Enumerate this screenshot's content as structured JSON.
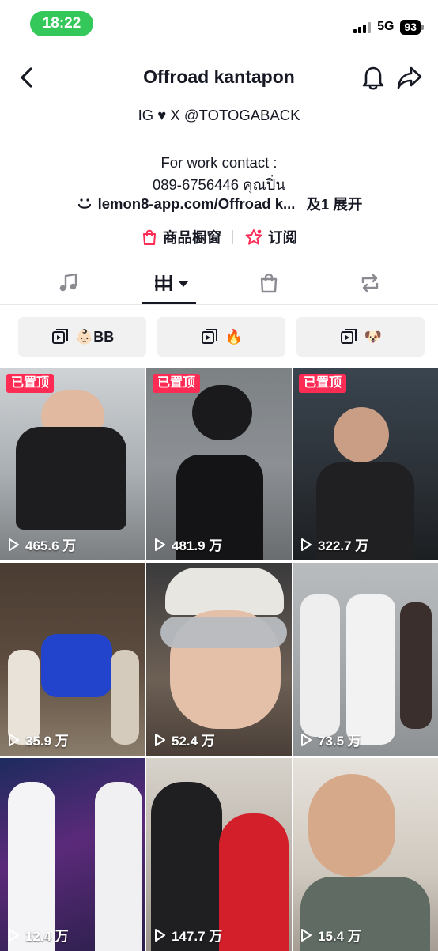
{
  "status": {
    "time": "18:22",
    "network": "5G",
    "battery": "93"
  },
  "nav": {
    "title": "Offroad kantapon"
  },
  "bio": {
    "line1": "IG ♥ X @TOTOGABACK",
    "line2": "For work contact :",
    "line3": "089-6756446 คุณปิ่น",
    "link": "lemon8-app.com/Offroad k...",
    "expand": "及1 展开"
  },
  "pills": {
    "shop": "商品橱窗",
    "subscribe": "订阅"
  },
  "tabs": [
    "music-icon",
    "grid-icon",
    "bag-icon",
    "repost-icon"
  ],
  "collections": [
    {
      "label": "👶🏻BB"
    },
    {
      "label": "🔥"
    },
    {
      "label": "🐶"
    }
  ],
  "videos": [
    {
      "pinned": "已置顶",
      "views": "465.6 万"
    },
    {
      "pinned": "已置顶",
      "views": "481.9 万"
    },
    {
      "pinned": "已置顶",
      "views": "322.7 万"
    },
    {
      "pinned": "",
      "views": "35.9 万"
    },
    {
      "pinned": "",
      "views": "52.4 万"
    },
    {
      "pinned": "",
      "views": "73.5 万"
    },
    {
      "pinned": "",
      "views": "12.4 万"
    },
    {
      "pinned": "",
      "views": "147.7 万"
    },
    {
      "pinned": "",
      "views": "15.4 万"
    }
  ],
  "colors": {
    "pinned": "#fe2c55",
    "status_pill": "#34c759",
    "collection_bg": "#f1f1f2"
  }
}
